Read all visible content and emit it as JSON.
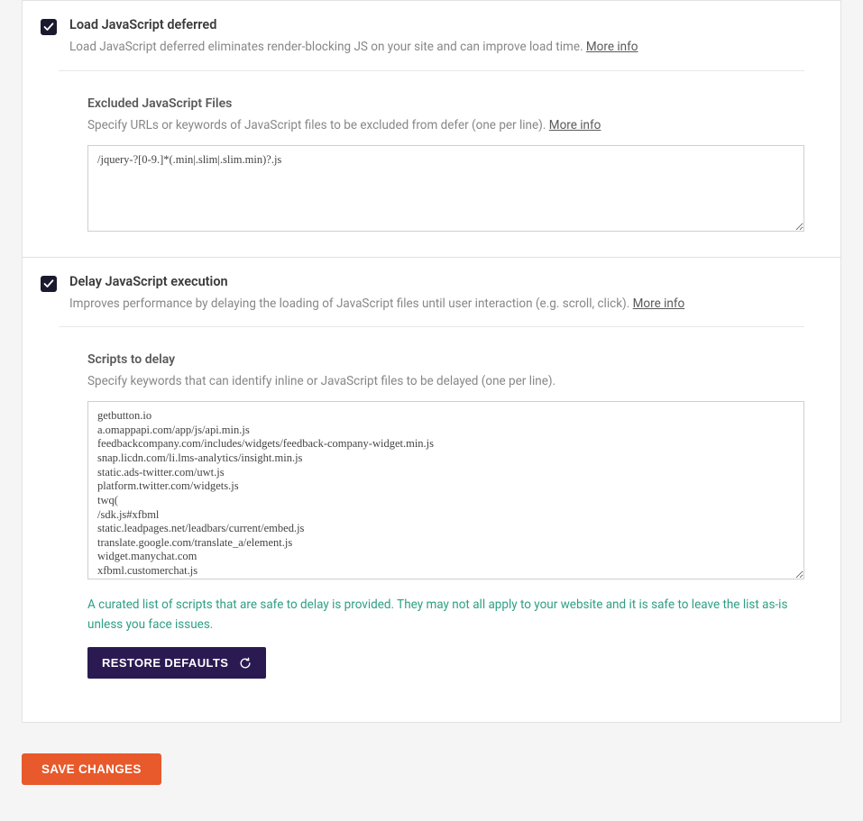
{
  "sections": {
    "defer": {
      "title": "Load JavaScript deferred",
      "desc": "Load JavaScript deferred eliminates render-blocking JS on your site and can improve load time. ",
      "more": "More info",
      "excluded": {
        "title": "Excluded JavaScript Files",
        "desc": "Specify URLs or keywords of JavaScript files to be excluded from defer (one per line). ",
        "more": "More info",
        "value": "/jquery-?[0-9.]*(.min|.slim|.slim.min)?.js"
      }
    },
    "delay": {
      "title": "Delay JavaScript execution",
      "desc": "Improves performance by delaying the loading of JavaScript files until user interaction (e.g. scroll, click). ",
      "more": "More info",
      "scripts": {
        "title": "Scripts to delay",
        "desc": "Specify keywords that can identify inline or JavaScript files to be delayed (one per line).",
        "value": "getbutton.io\na.omappapi.com/app/js/api.min.js\nfeedbackcompany.com/includes/widgets/feedback-company-widget.min.js\nsnap.licdn.com/li.lms-analytics/insight.min.js\nstatic.ads-twitter.com/uwt.js\nplatform.twitter.com/widgets.js\ntwq(\n/sdk.js#xfbml\nstatic.leadpages.net/leadbars/current/embed.js\ntranslate.google.com/translate_a/element.js\nwidget.manychat.com\nxfbml.customerchat.js",
        "note": "A curated list of scripts that are safe to delay is provided. They may not all apply to your website and it is safe to leave the list as-is unless you face issues."
      }
    }
  },
  "buttons": {
    "restore": "RESTORE DEFAULTS",
    "save": "SAVE CHANGES"
  }
}
